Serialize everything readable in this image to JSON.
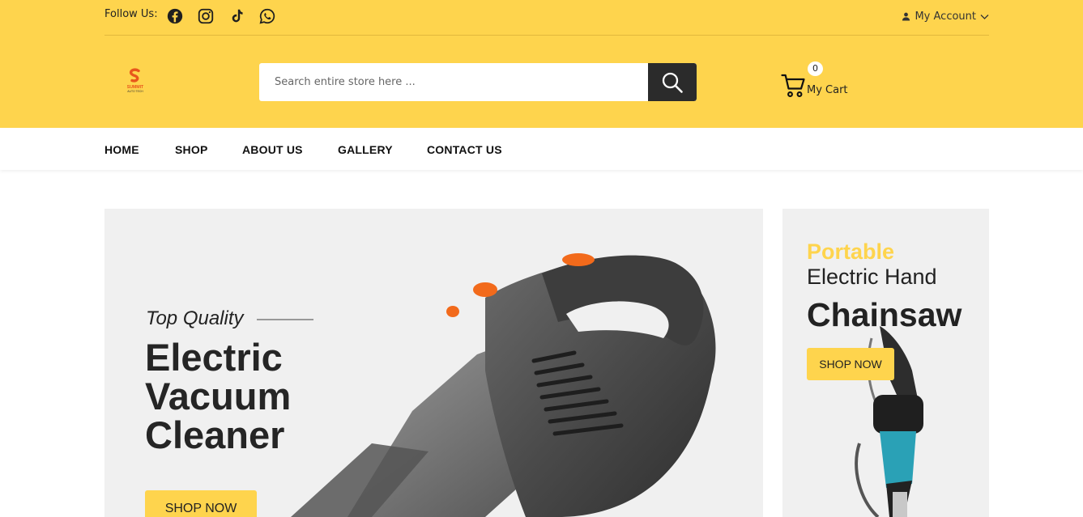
{
  "topbar": {
    "follow_label": "Follow Us:",
    "social": [
      "facebook-icon",
      "instagram-icon",
      "tiktok-icon",
      "whatsapp-icon"
    ],
    "account_label": "My Account"
  },
  "header": {
    "logo_text": "SUMMIT",
    "logo_subtext": "AUTO TECH",
    "search_placeholder": "Search entire store here ...",
    "cart_count": "0",
    "cart_label": "My Cart"
  },
  "nav": {
    "items": [
      "HOME",
      "SHOP",
      "ABOUT US",
      "GALLERY",
      "CONTACT US"
    ]
  },
  "banner_main": {
    "subtitle": "Top Quality",
    "title_line1": "Electric",
    "title_line2": "Vacuum",
    "title_line3": "Cleaner",
    "button": "SHOP NOW"
  },
  "banner_side": {
    "highlight": "Portable",
    "subtitle": "Electric Hand",
    "title": "Chainsaw",
    "button": "SHOP NOW"
  },
  "colors": {
    "brand_yellow": "#fed44d",
    "dark": "#2b2b2b",
    "banner_bg": "#f0f0f0"
  }
}
